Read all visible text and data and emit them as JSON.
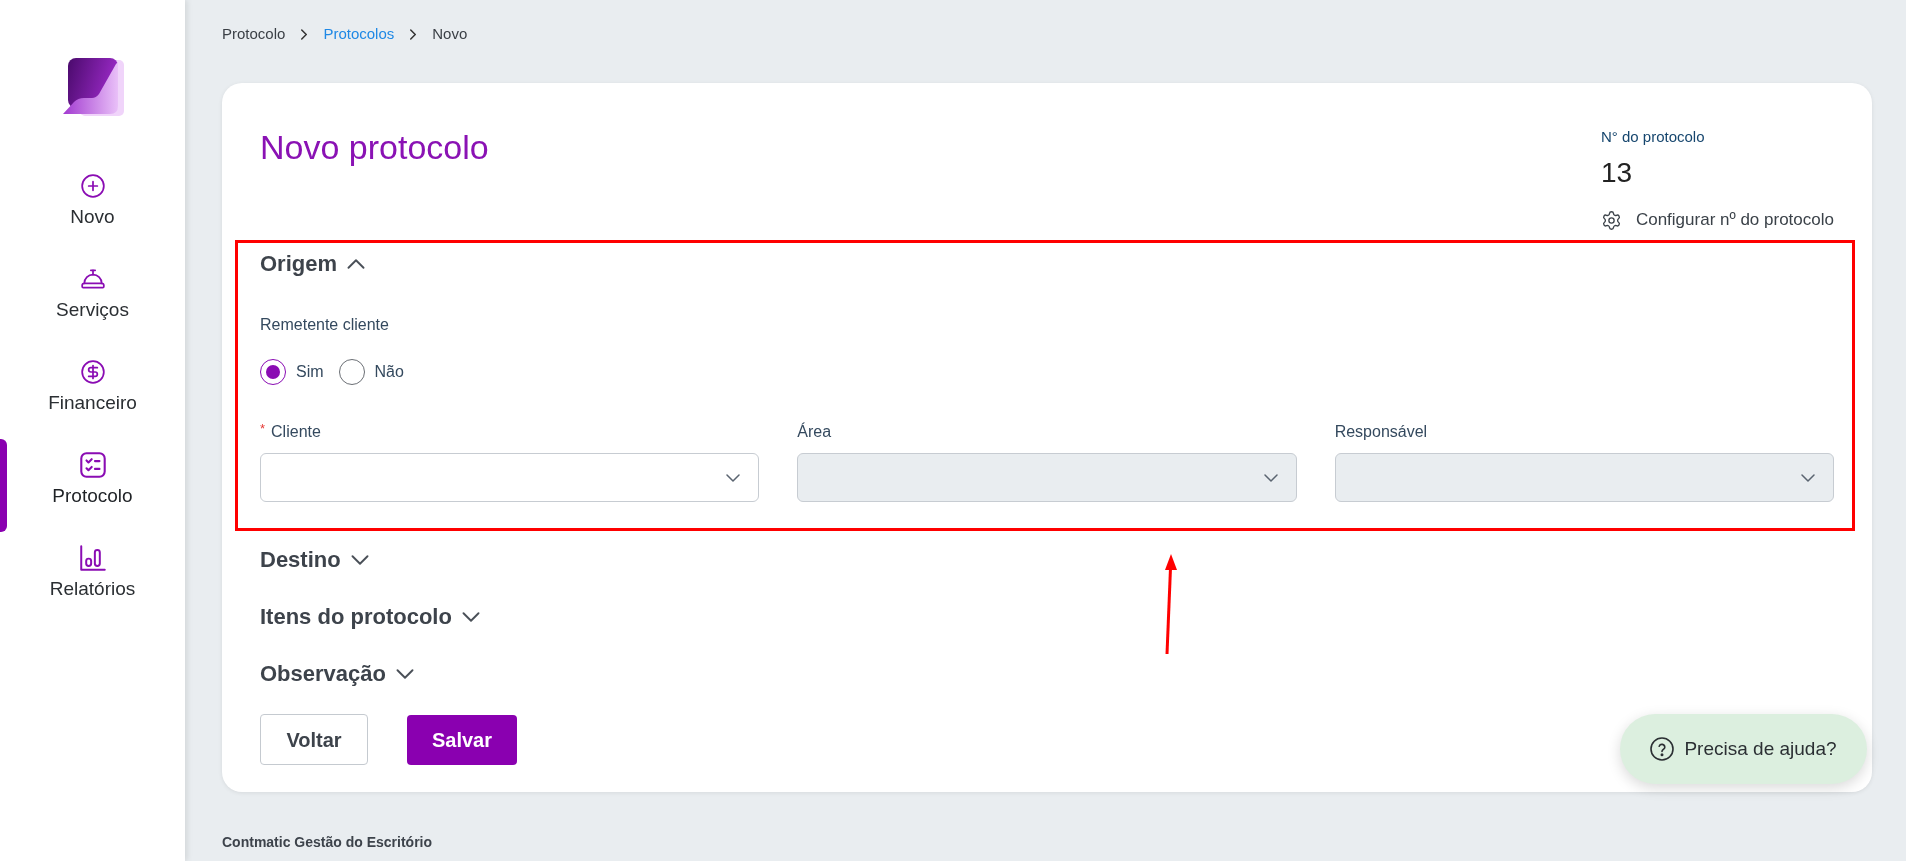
{
  "sidebar": {
    "items": [
      {
        "label": "Novo",
        "selected": false
      },
      {
        "label": "Serviços",
        "selected": false
      },
      {
        "label": "Financeiro",
        "selected": false
      },
      {
        "label": "Protocolo",
        "selected": true
      },
      {
        "label": "Relatórios",
        "selected": false
      }
    ]
  },
  "breadcrumb": [
    {
      "label": "Protocolo",
      "kind": "text"
    },
    {
      "label": "Protocolos",
      "kind": "link"
    },
    {
      "label": "Novo",
      "kind": "text"
    }
  ],
  "page": {
    "title": "Novo protocolo"
  },
  "protocol_number": {
    "label": "N° do protocolo",
    "value": "13",
    "configure_link": "Configurar nº do protocolo"
  },
  "sections": [
    {
      "title": "Origem",
      "expanded": true,
      "highlighted": true,
      "radio_group": {
        "label": "Remetente cliente",
        "options": [
          {
            "label": "Sim",
            "selected": true
          },
          {
            "label": "Não",
            "selected": false
          }
        ]
      },
      "fields": [
        {
          "label": "Cliente",
          "required_mark": "*",
          "disabled": false
        },
        {
          "label": "Área",
          "disabled": true
        },
        {
          "label": "Responsável",
          "disabled": true
        }
      ]
    },
    {
      "title": "Destino",
      "expanded": false,
      "highlighted": false
    },
    {
      "title": "Itens do protocolo",
      "expanded": false,
      "highlighted": false
    },
    {
      "title": "Observação",
      "expanded": false,
      "highlighted": false
    }
  ],
  "buttons": [
    {
      "label": "Voltar",
      "kind": "secondary"
    },
    {
      "label": "Salvar",
      "kind": "primary"
    }
  ],
  "help_button": {
    "label": "Precisa de ajuda?"
  },
  "footer": {
    "text": "Contmatic Gestão do Escritório"
  }
}
